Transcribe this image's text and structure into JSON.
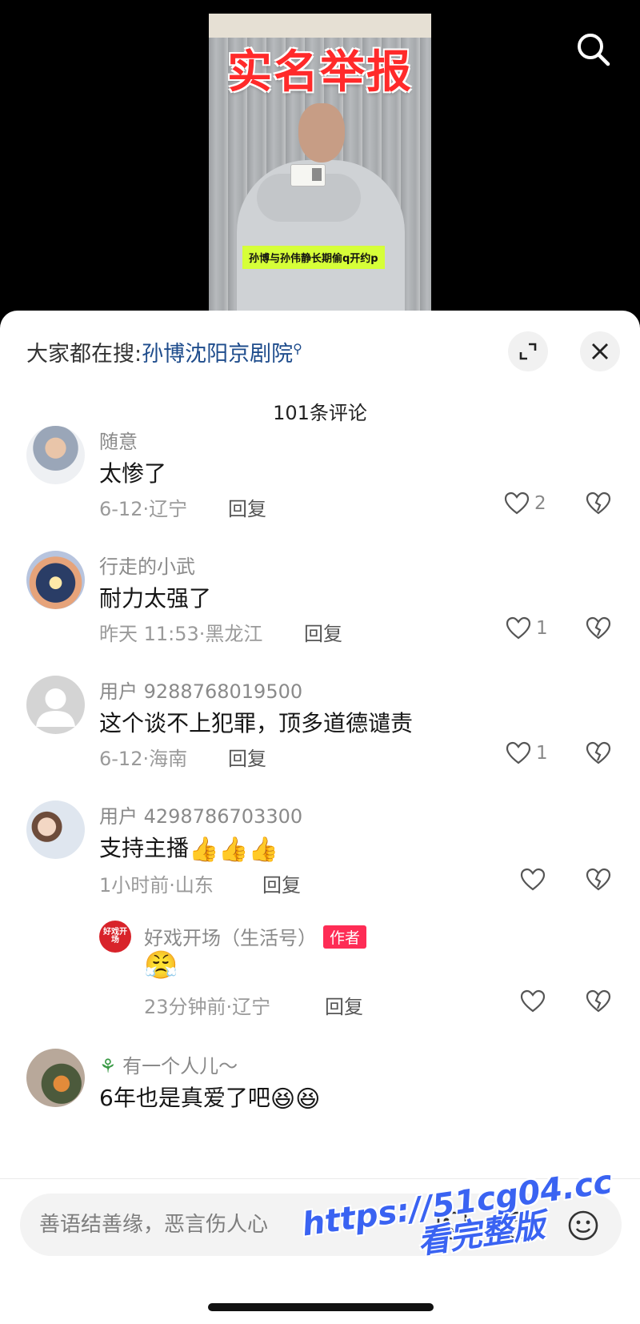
{
  "video": {
    "title": "实名举报",
    "caption": "孙博与孙伟静长期偷q开约p"
  },
  "sheet": {
    "search_prefix": "大家都在搜:",
    "search_term": "孙博沈阳京剧院",
    "comment_count": "101条评论"
  },
  "comments": [
    {
      "user": "随意",
      "text": "太惨了",
      "time": "6-12·辽宁",
      "reply": "回复",
      "likes": "2"
    },
    {
      "user": "行走的小武",
      "text": "耐力太强了",
      "time": "昨天 11:53·黑龙江",
      "reply": "回复",
      "likes": "1"
    },
    {
      "user": "用户 9288768019500",
      "text": "这个谈不上犯罪，顶多道德谴责",
      "time": "6-12·海南",
      "reply": "回复",
      "likes": "1"
    },
    {
      "user": "用户 4298786703300",
      "text": "支持主播",
      "emoji": "👍👍👍",
      "time": "1小时前·山东",
      "reply": "回复",
      "likes": ""
    },
    {
      "user": "好戏开场（生活号）",
      "badge": "作者",
      "avatar_text": "好戏开场",
      "emoji": "😤",
      "time": "23分钟前·辽宁",
      "reply": "回复",
      "likes": ""
    },
    {
      "user": "有一个人儿～",
      "text": "6年也是真爱了吧",
      "emoji": "😆😆"
    }
  ],
  "input": {
    "placeholder": "善语结善缘，恶言伤人心"
  },
  "watermark": {
    "line1": "https://51cg04.cc",
    "line2": "看完整版"
  },
  "colors": {
    "accent": "#fe2c55",
    "link": "#1e4c8c",
    "watermark": "#3a63f2",
    "caption_bg": "#d6ff38"
  }
}
